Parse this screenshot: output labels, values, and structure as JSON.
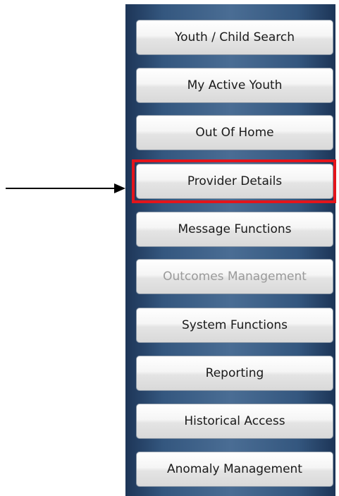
{
  "nav": {
    "items": [
      {
        "label": "Youth / Child Search",
        "disabled": false
      },
      {
        "label": "My Active Youth",
        "disabled": false
      },
      {
        "label": "Out Of Home",
        "disabled": false
      },
      {
        "label": "Provider Details",
        "disabled": false,
        "highlighted": true
      },
      {
        "label": "Message Functions",
        "disabled": false
      },
      {
        "label": "Outcomes Management",
        "disabled": true
      },
      {
        "label": "System Functions",
        "disabled": false
      },
      {
        "label": "Reporting",
        "disabled": false
      },
      {
        "label": "Historical Access",
        "disabled": false
      },
      {
        "label": "Anomaly Management",
        "disabled": false
      }
    ]
  },
  "annotation": {
    "highlight_color": "#e4141b",
    "arrow_color": "#000000"
  },
  "colors": {
    "panel": "#34577f",
    "disabled_text": "#9a9a9a"
  }
}
